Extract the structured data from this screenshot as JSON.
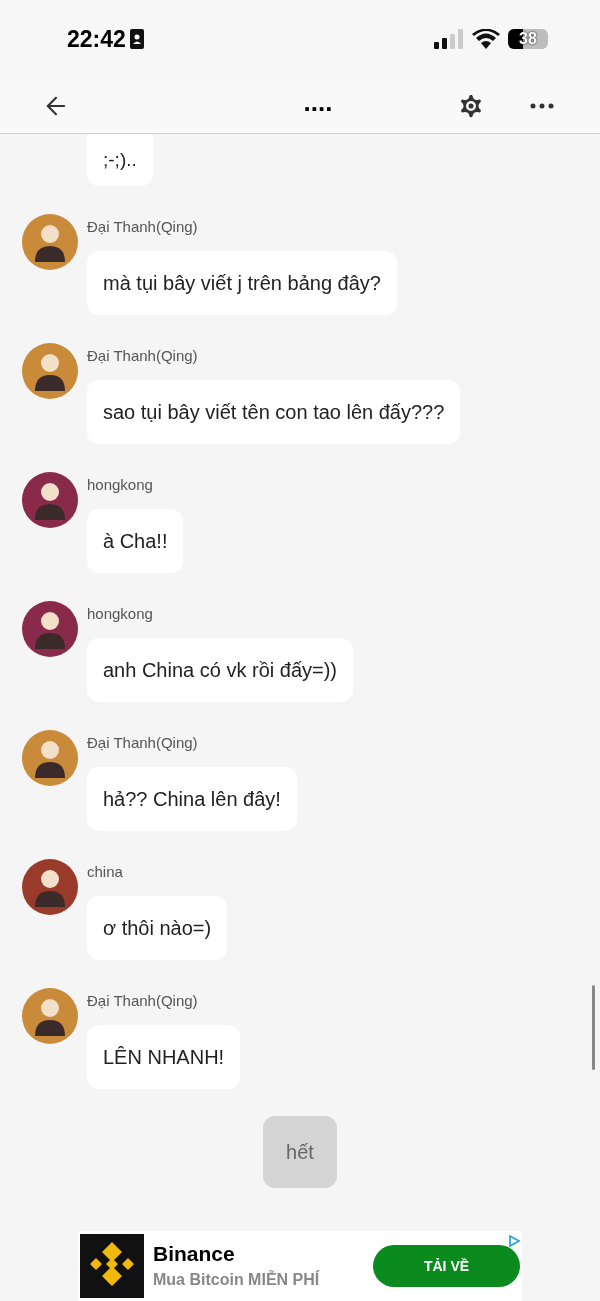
{
  "status_bar": {
    "time": "22:42",
    "battery": "38"
  },
  "nav": {
    "title": "...."
  },
  "first_message": {
    "text": ";-;).."
  },
  "messages": [
    {
      "sender": "Đại Thanh(Qing)",
      "text": "mà tụi bây viết j trên bảng đây?",
      "color": "#c98a3a"
    },
    {
      "sender": "Đại Thanh(Qing)",
      "text": "sao tụi bây viết tên con tao lên đấy???",
      "color": "#c98a3a"
    },
    {
      "sender": "hongkong",
      "text": "à Cha!!",
      "color": "#8a2a4a"
    },
    {
      "sender": "hongkong",
      "text": "anh China có vk rồi đấy=))",
      "color": "#8a2a4a"
    },
    {
      "sender": "Đại Thanh(Qing)",
      "text": "hả?? China lên đây!",
      "color": "#c98a3a"
    },
    {
      "sender": "china",
      "text": "ơ thôi nào=)",
      "color": "#9a3a2a"
    },
    {
      "sender": "Đại Thanh(Qing)",
      "text": "LÊN NHANH!",
      "color": "#c98a3a"
    }
  ],
  "end_button": "hết",
  "ad": {
    "title": "Binance",
    "subtitle": "Mua Bitcoin MIỄN PHÍ",
    "cta": "TẢI VỀ"
  }
}
